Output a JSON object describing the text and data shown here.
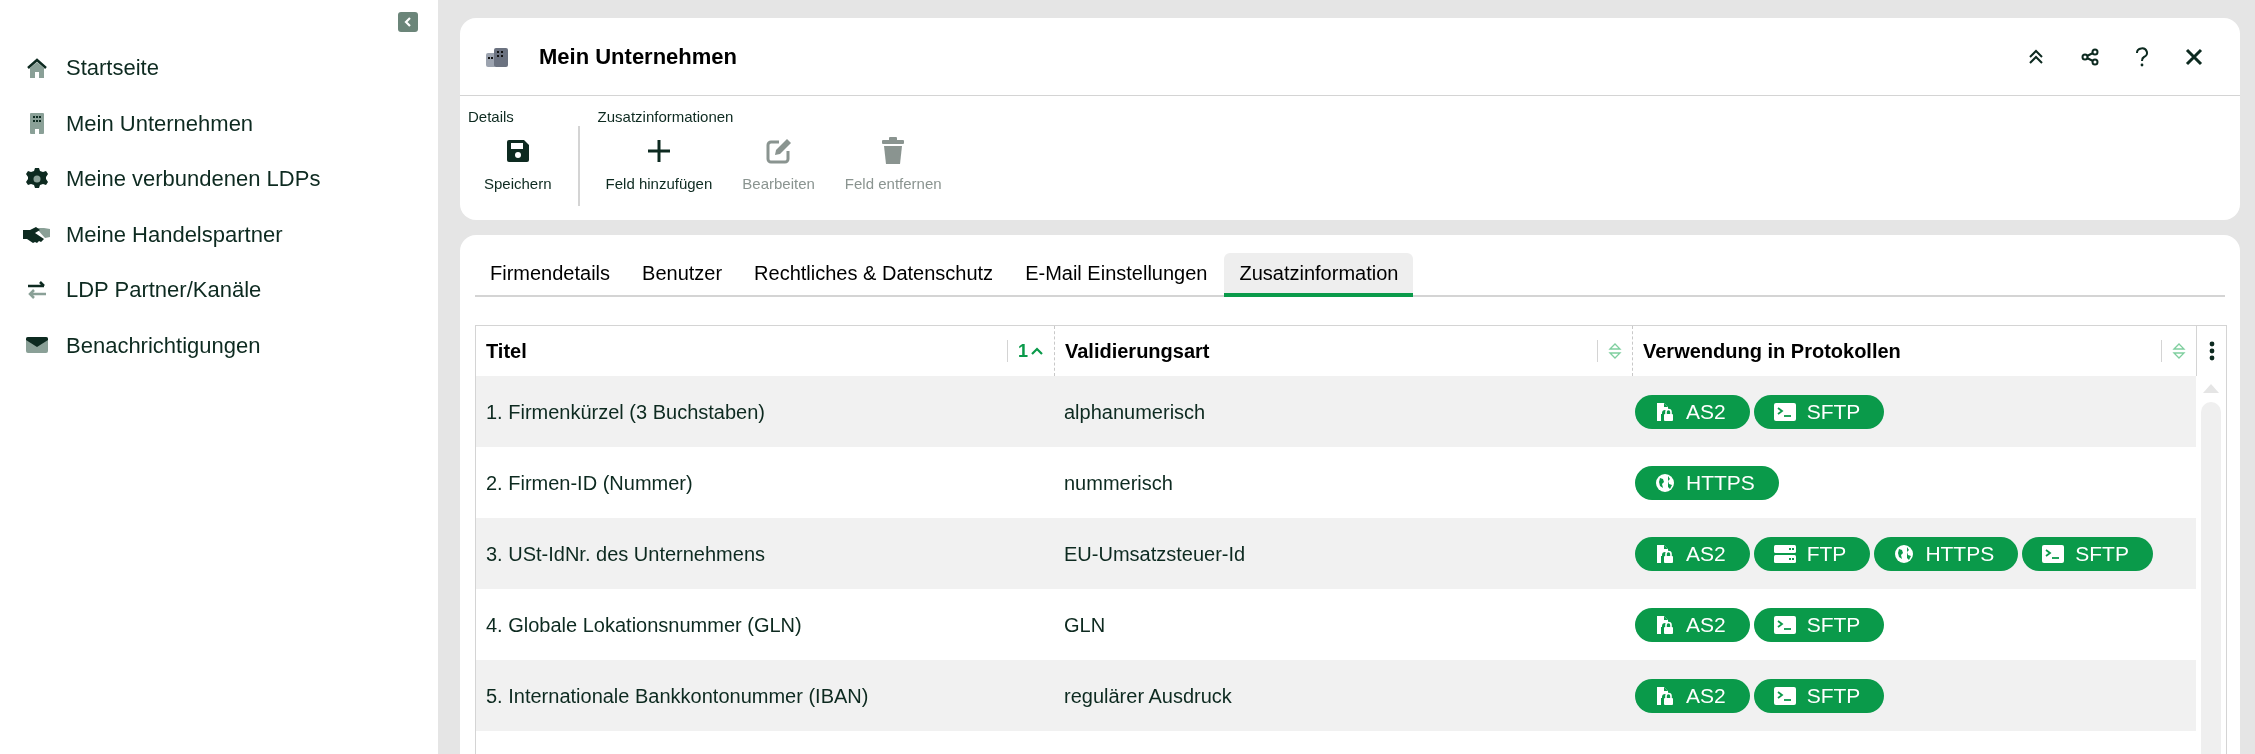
{
  "sidebar": {
    "items": [
      {
        "label": "Startseite",
        "kind": "home"
      },
      {
        "label": "Mein Unternehmen",
        "kind": "building"
      },
      {
        "label": "Meine verbundenen LDPs",
        "kind": "gear"
      },
      {
        "label": "Meine Handelspartner",
        "kind": "handshake"
      },
      {
        "label": "LDP Partner/Kanäle",
        "kind": "arrows"
      },
      {
        "label": "Benachrichtigungen",
        "kind": "envelope"
      }
    ]
  },
  "header": {
    "title": "Mein Unternehmen"
  },
  "toolbar": {
    "groups": [
      {
        "label": "Details",
        "buttons": [
          {
            "label": "Speichern",
            "kind": "save",
            "disabled": false
          }
        ]
      },
      {
        "label": "Zusatzinformationen",
        "buttons": [
          {
            "label": "Feld hinzufügen",
            "kind": "plus",
            "disabled": false
          },
          {
            "label": "Bearbeiten",
            "kind": "edit",
            "disabled": true
          },
          {
            "label": "Feld entfernen",
            "kind": "trash",
            "disabled": true
          }
        ]
      }
    ]
  },
  "tabs": [
    {
      "label": "Firmendetails",
      "selected": false
    },
    {
      "label": "Benutzer",
      "selected": false
    },
    {
      "label": "Rechtliches & Datenschutz",
      "selected": false
    },
    {
      "label": "E-Mail Einstellungen",
      "selected": false
    },
    {
      "label": "Zusatzinformation",
      "selected": true
    }
  ],
  "table": {
    "columns": [
      {
        "label": "Titel",
        "kind": "asc",
        "sort_index": "1"
      },
      {
        "label": "Validierungsart",
        "kind": "none"
      },
      {
        "label": "Verwendung in Protokollen",
        "kind": "none"
      }
    ],
    "rows": [
      {
        "title": "1. Firmenkürzel (3 Buchstaben)",
        "validation": "alphanumerisch",
        "protocols": [
          {
            "kind": "as2",
            "label": "AS2"
          },
          {
            "kind": "sftp",
            "label": "SFTP"
          }
        ]
      },
      {
        "title": "2. Firmen-ID (Nummer)",
        "validation": "nummerisch",
        "protocols": [
          {
            "kind": "https",
            "label": "HTTPS"
          }
        ]
      },
      {
        "title": "3. USt-IdNr. des Unternehmens",
        "validation": "EU-Umsatzsteuer-Id",
        "protocols": [
          {
            "kind": "as2",
            "label": "AS2"
          },
          {
            "kind": "ftp",
            "label": "FTP"
          },
          {
            "kind": "https",
            "label": "HTTPS"
          },
          {
            "kind": "sftp",
            "label": "SFTP"
          }
        ]
      },
      {
        "title": "4. Globale Lokationsnummer (GLN)",
        "validation": "GLN",
        "protocols": [
          {
            "kind": "as2",
            "label": "AS2"
          },
          {
            "kind": "sftp",
            "label": "SFTP"
          }
        ]
      },
      {
        "title": "5. Internationale Bankkontonummer (IBAN)",
        "validation": "regulärer Ausdruck",
        "protocols": [
          {
            "kind": "as2",
            "label": "AS2"
          },
          {
            "kind": "sftp",
            "label": "SFTP"
          }
        ]
      }
    ]
  }
}
